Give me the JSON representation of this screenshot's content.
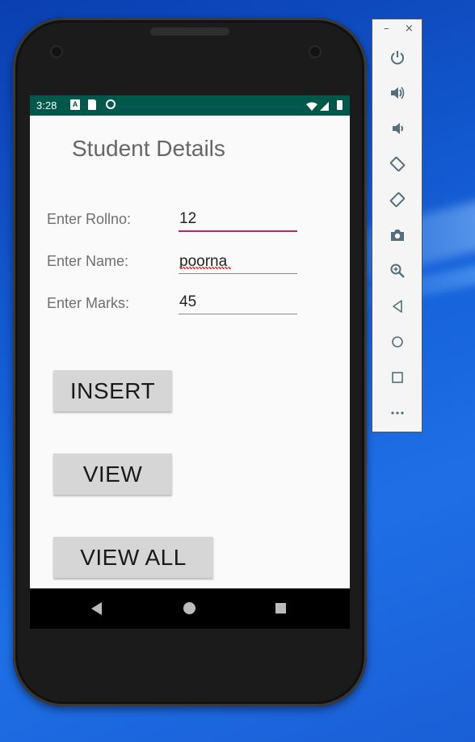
{
  "status_bar": {
    "time": "3:28"
  },
  "app": {
    "title": "Student Details",
    "rows": [
      {
        "label": "Enter Rollno:",
        "value": "12"
      },
      {
        "label": "Enter Name:",
        "value": "poorna"
      },
      {
        "label": "Enter Marks:",
        "value": "45"
      }
    ],
    "buttons": {
      "insert": "INSERT",
      "view": "VIEW",
      "view_all": "VIEW ALL"
    }
  },
  "colors": {
    "status_bar": "#00574b",
    "accent": "#d81b60",
    "button": "#d6d6d6"
  },
  "emulator_toolbar": {
    "window_controls": [
      "–",
      "×"
    ],
    "tools": [
      "power-icon",
      "volume-up-icon",
      "volume-down-icon",
      "rotate-left-icon",
      "rotate-right-icon",
      "camera-icon",
      "zoom-icon",
      "back-icon",
      "home-icon",
      "overview-icon",
      "more-icon"
    ]
  }
}
